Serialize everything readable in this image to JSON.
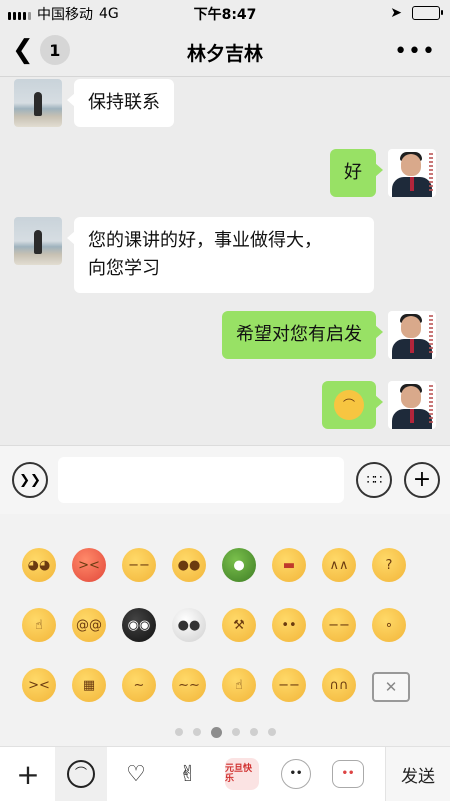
{
  "status_bar": {
    "carrier": "中国移动",
    "network": "4G",
    "time": "下午8:47"
  },
  "nav": {
    "unread_count": "1",
    "title": "林夕吉林",
    "more_label": "•••"
  },
  "messages": [
    {
      "side": "left",
      "text": "保持联系",
      "avatar": "beach-photo"
    },
    {
      "side": "right",
      "text": "好",
      "avatar": "man-in-suit"
    },
    {
      "side": "left",
      "text": "您的课讲的好，事业做得大，\n向您学习",
      "avatar": "beach-photo"
    },
    {
      "side": "right",
      "text": "希望对您有启发",
      "avatar": "man-in-suit"
    },
    {
      "side": "right",
      "text": "",
      "emoji": "grinning-face",
      "avatar": "man-in-suit"
    }
  ],
  "input_bar": {
    "voice_icon": "voice-icon",
    "keyboard_icon": "keyboard-icon",
    "plus_icon": "plus-circle-icon",
    "text_value": ""
  },
  "emoji_panel": {
    "rows": [
      [
        "rolling-eyes",
        "angry",
        "smirk",
        "grin",
        "turtle",
        "headband",
        "drooling",
        "confused"
      ],
      [
        "shush",
        "dizzy",
        "skull-black",
        "skull",
        "hammer",
        "thinking",
        "sweat",
        "whistle"
      ],
      [
        "laugh-tears",
        "grimace",
        "kiss",
        "sly",
        "pick-nose",
        "shrug",
        "sob",
        "delete"
      ]
    ],
    "page_count": 6,
    "active_page": 3
  },
  "bottom_tabs": {
    "items": [
      "add-icon",
      "emoji-face-icon",
      "heart-icon",
      "peace-hand-icon",
      "sticker-yuandan",
      "sticker-bun",
      "sticker-cat"
    ],
    "sticker_text": "元旦快乐",
    "send_label": "发送"
  },
  "colors": {
    "accent_bubble": "#98e165",
    "background": "#ececec"
  }
}
